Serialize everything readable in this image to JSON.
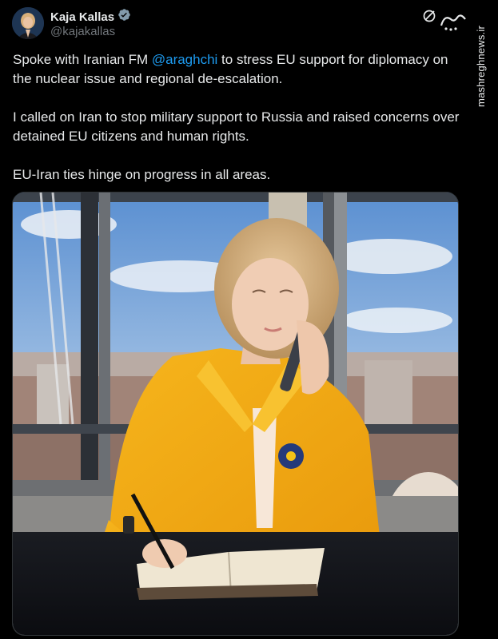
{
  "author": {
    "display_name": "Kaja Kallas",
    "handle": "@kajakallas",
    "verified_icon": "verified-badge-icon"
  },
  "tweet": {
    "p1_before": "Spoke with Iranian FM ",
    "p1_mention": "@araghchi",
    "p1_after": " to stress EU support for diplomacy on the nuclear issue and regional de-escalation.",
    "p2": "I called on Iran to stop military support to Russia and raised concerns over detained EU citizens and human rights.",
    "p3": "EU-Iran ties hinge on progress in all areas."
  },
  "watermark": {
    "site": "mashreghnews.ir"
  },
  "colors": {
    "background": "#000000",
    "text": "#e7e9ea",
    "muted": "#71767b",
    "link": "#1d9bf0",
    "verified": "#829aab"
  }
}
